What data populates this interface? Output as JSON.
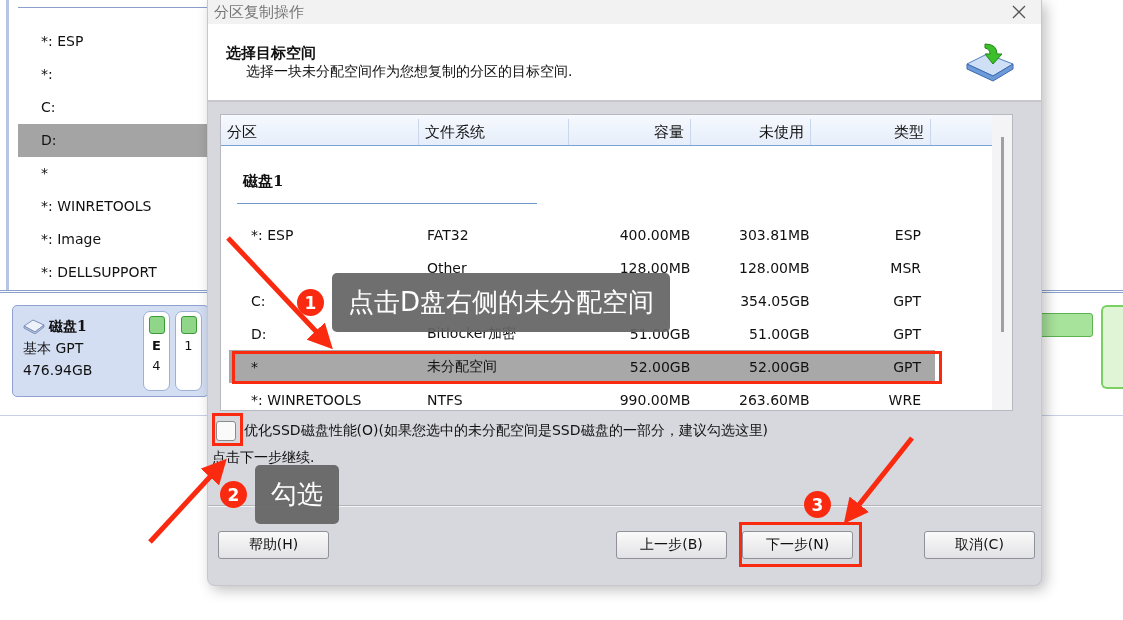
{
  "background_app": {
    "partition_list": [
      {
        "label": "*: ESP",
        "selected": false
      },
      {
        "label": "*:",
        "selected": false
      },
      {
        "label": "C:",
        "selected": false
      },
      {
        "label": "D:",
        "selected": true
      },
      {
        "label": "*",
        "selected": false
      },
      {
        "label": "*: WINRETOOLS",
        "selected": false
      },
      {
        "label": "*: Image",
        "selected": false
      },
      {
        "label": "*: DELLSUPPORT",
        "selected": false
      }
    ],
    "disk": {
      "name": "磁盘1",
      "style": "基本 GPT",
      "size": "476.94GB",
      "tiles": [
        {
          "letter": "E",
          "size": "4"
        },
        {
          "size": "1"
        }
      ]
    }
  },
  "dialog": {
    "title": "分区复制操作",
    "heading": "选择目标空间",
    "subtitle": "选择一块未分配空间作为您想复制的分区的目标空间.",
    "table": {
      "columns": [
        "分区",
        "文件系统",
        "容量",
        "未使用",
        "类型"
      ],
      "group": "磁盘1",
      "rows": [
        {
          "partition": "*:  ESP",
          "filesystem": "FAT32",
          "capacity": "400.00MB",
          "unused": "303.81MB",
          "type": "ESP",
          "selected": false
        },
        {
          "filesystem": "Other",
          "capacity": "128.00MB",
          "unused": "128.00MB",
          "type": "MSR",
          "selected": false
        },
        {
          "partition": "C:",
          "unused": "354.05GB",
          "type": "GPT",
          "selected": false
        },
        {
          "partition": "D:",
          "filesystem": "Bitlocker加密",
          "capacity": "51.00GB",
          "unused": "51.00GB",
          "type": "GPT",
          "selected": false
        },
        {
          "partition": "*",
          "filesystem": "未分配空间",
          "capacity": "52.00GB",
          "unused": "52.00GB",
          "type": "GPT",
          "selected": true
        },
        {
          "partition": "*:  WINRETOOLS",
          "filesystem": "NTFS",
          "capacity": "990.00MB",
          "unused": "263.60MB",
          "type": "WRE",
          "selected": false
        }
      ]
    },
    "ssd_option": {
      "label": "优化SSD磁盘性能(O)(如果您选中的未分配空间是SSD磁盘的一部分，建议勾选这里)",
      "checked": false
    },
    "hint": "点击下一步继续.",
    "buttons": [
      {
        "label": "帮助(H)",
        "kind": "help"
      },
      {
        "label": "上一步(B)",
        "kind": "back"
      },
      {
        "label": "下一步(N)",
        "kind": "next"
      },
      {
        "label": "取消(C)",
        "kind": "cancel"
      }
    ]
  },
  "annotations": [
    {
      "number": "1",
      "text": "点击D盘右侧的未分配空间"
    },
    {
      "number": "2",
      "text": "勾选"
    },
    {
      "number": "3"
    }
  ]
}
